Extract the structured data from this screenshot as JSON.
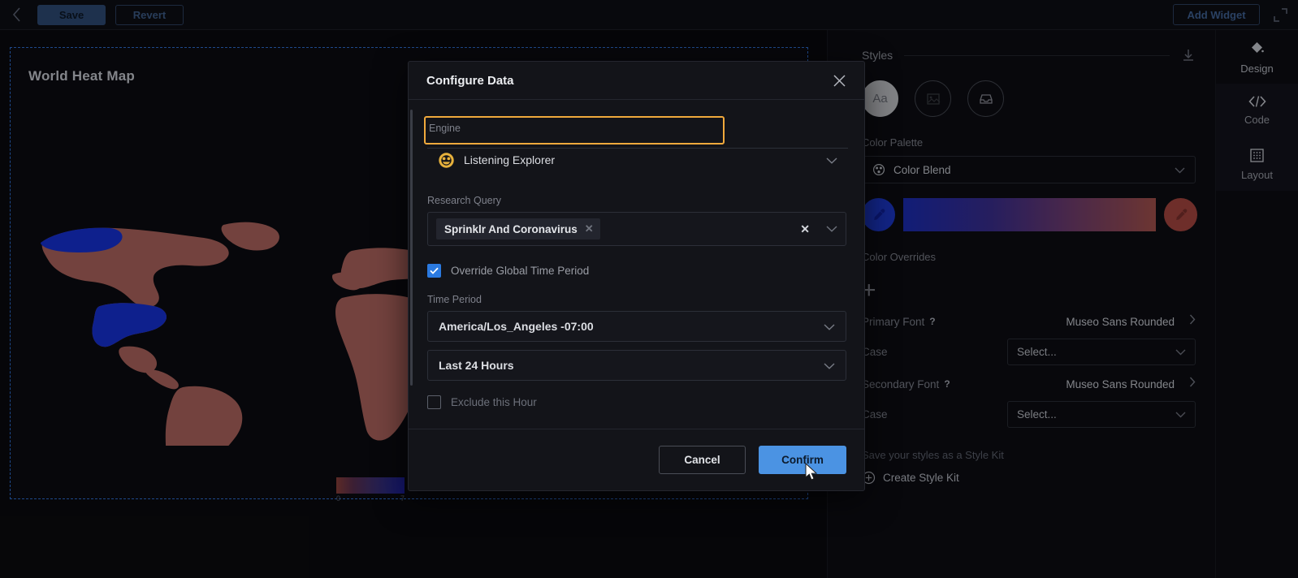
{
  "topbar": {
    "back_icon": "chevron-left-icon",
    "save_label": "Save",
    "revert_label": "Revert",
    "add_widget_label": "Add Widget",
    "expand_icon": "expand-icon"
  },
  "canvas": {
    "widget": {
      "title": "World Heat Map",
      "legend": {
        "min": "0",
        "max": "7"
      }
    }
  },
  "styles_panel": {
    "title": "Styles",
    "download_icon": "download-icon",
    "circles": [
      {
        "name": "typography-style-button",
        "glyph": "Aa"
      },
      {
        "name": "image-style-button",
        "glyph": ""
      },
      {
        "name": "card-style-button",
        "glyph": ""
      }
    ],
    "color_palette_label": "Color Palette",
    "color_palette_value": "Color Blend",
    "color_palette_icon": "palette-icon",
    "color_overrides_label": "Color Overrides",
    "add_override_label": "+",
    "gradient_start": "#1a2bb4",
    "gradient_end": "#a5514a",
    "primary_font_label": "Primary Font",
    "primary_font_value": "Museo Sans Rounded",
    "primary_case_label": "Case",
    "primary_case_value": "Select...",
    "secondary_font_label": "Secondary Font",
    "secondary_font_value": "Museo Sans Rounded",
    "secondary_case_label": "Case",
    "secondary_case_value": "Select...",
    "style_kit_note": "Save your styles as a Style Kit",
    "create_style_kit_label": "Create Style Kit"
  },
  "rail": {
    "items": [
      {
        "label": "Design",
        "icon": "design-diamond-icon",
        "active": true
      },
      {
        "label": "Code",
        "icon": "code-icon",
        "active": false
      },
      {
        "label": "Layout",
        "icon": "layout-grid-icon",
        "active": false
      }
    ]
  },
  "dialog": {
    "title": "Configure Data",
    "close_icon": "close-icon",
    "engine_label": "Engine",
    "engine_value": "Listening Explorer",
    "engine_icon": "listening-explorer-icon",
    "engine_highlight_color": "#f0a93c",
    "research_query_label": "Research Query",
    "research_query_chips": [
      "Sprinklr And Coronavirus"
    ],
    "override_checkbox_label": "Override Global Time Period",
    "override_checked": true,
    "time_period_label": "Time Period",
    "timezone_value": "America/Los_Angeles -07:00",
    "range_value": "Last 24 Hours",
    "exclude_hour_label": "Exclude this Hour",
    "exclude_checked": false,
    "cancel_label": "Cancel",
    "confirm_label": "Confirm"
  }
}
